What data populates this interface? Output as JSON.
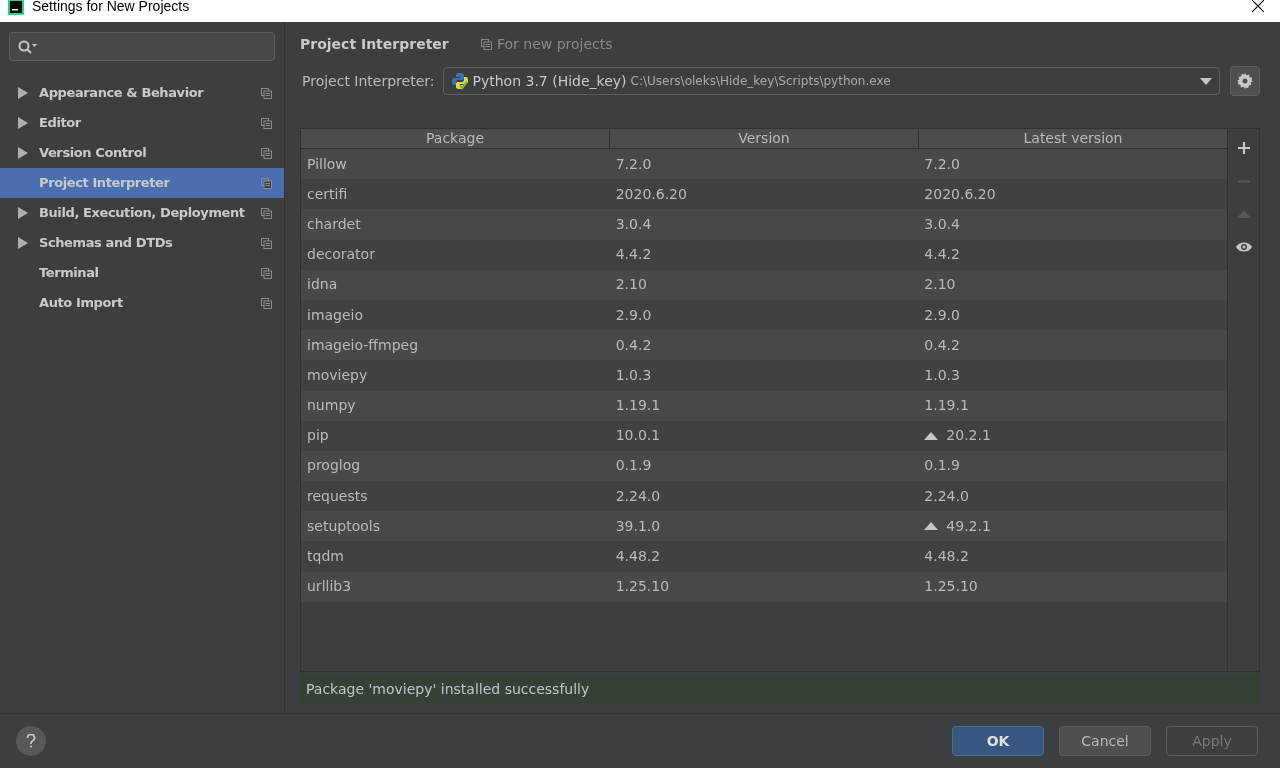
{
  "window": {
    "title": "Settings for New Projects"
  },
  "sidebar": {
    "items": [
      {
        "label": "Appearance & Behavior",
        "expandable": true,
        "selected": false
      },
      {
        "label": "Editor",
        "expandable": true,
        "selected": false
      },
      {
        "label": "Version Control",
        "expandable": true,
        "selected": false
      },
      {
        "label": "Project Interpreter",
        "expandable": false,
        "selected": true
      },
      {
        "label": "Build, Execution, Deployment",
        "expandable": true,
        "selected": false
      },
      {
        "label": "Schemas and DTDs",
        "expandable": true,
        "selected": false
      },
      {
        "label": "Terminal",
        "expandable": false,
        "selected": false
      },
      {
        "label": "Auto Import",
        "expandable": false,
        "selected": false
      }
    ]
  },
  "header": {
    "title": "Project Interpreter",
    "scope": "For new projects"
  },
  "interpreter": {
    "label": "Project Interpreter:",
    "name": "Python 3.7 (Hide_key)",
    "path": "C:\\Users\\oleks\\Hide_key\\Scripts\\python.exe"
  },
  "table": {
    "columns": [
      "Package",
      "Version",
      "Latest version"
    ],
    "rows": [
      {
        "package": "Pillow",
        "version": "7.2.0",
        "latest": "7.2.0",
        "upgrade": false
      },
      {
        "package": "certifi",
        "version": "2020.6.20",
        "latest": "2020.6.20",
        "upgrade": false
      },
      {
        "package": "chardet",
        "version": "3.0.4",
        "latest": "3.0.4",
        "upgrade": false
      },
      {
        "package": "decorator",
        "version": "4.4.2",
        "latest": "4.4.2",
        "upgrade": false
      },
      {
        "package": "idna",
        "version": "2.10",
        "latest": "2.10",
        "upgrade": false
      },
      {
        "package": "imageio",
        "version": "2.9.0",
        "latest": "2.9.0",
        "upgrade": false
      },
      {
        "package": "imageio-ffmpeg",
        "version": "0.4.2",
        "latest": "0.4.2",
        "upgrade": false
      },
      {
        "package": "moviepy",
        "version": "1.0.3",
        "latest": "1.0.3",
        "upgrade": false
      },
      {
        "package": "numpy",
        "version": "1.19.1",
        "latest": "1.19.1",
        "upgrade": false
      },
      {
        "package": "pip",
        "version": "10.0.1",
        "latest": "20.2.1",
        "upgrade": true
      },
      {
        "package": "proglog",
        "version": "0.1.9",
        "latest": "0.1.9",
        "upgrade": false
      },
      {
        "package": "requests",
        "version": "2.24.0",
        "latest": "2.24.0",
        "upgrade": false
      },
      {
        "package": "setuptools",
        "version": "39.1.0",
        "latest": "49.2.1",
        "upgrade": true
      },
      {
        "package": "tqdm",
        "version": "4.48.2",
        "latest": "4.48.2",
        "upgrade": false
      },
      {
        "package": "urllib3",
        "version": "1.25.10",
        "latest": "1.25.10",
        "upgrade": false
      }
    ]
  },
  "toolbar": [
    {
      "kind": "add",
      "disabled": false
    },
    {
      "kind": "remove",
      "disabled": true
    },
    {
      "kind": "upgrade",
      "disabled": true
    },
    {
      "kind": "show",
      "disabled": false
    }
  ],
  "status": "Package 'moviepy' installed successfully",
  "buttons": [
    {
      "label": "OK",
      "kind": "primary",
      "disabled": false
    },
    {
      "label": "Cancel",
      "kind": "normal",
      "disabled": false
    },
    {
      "label": "Apply",
      "kind": "normal",
      "disabled": true
    }
  ]
}
